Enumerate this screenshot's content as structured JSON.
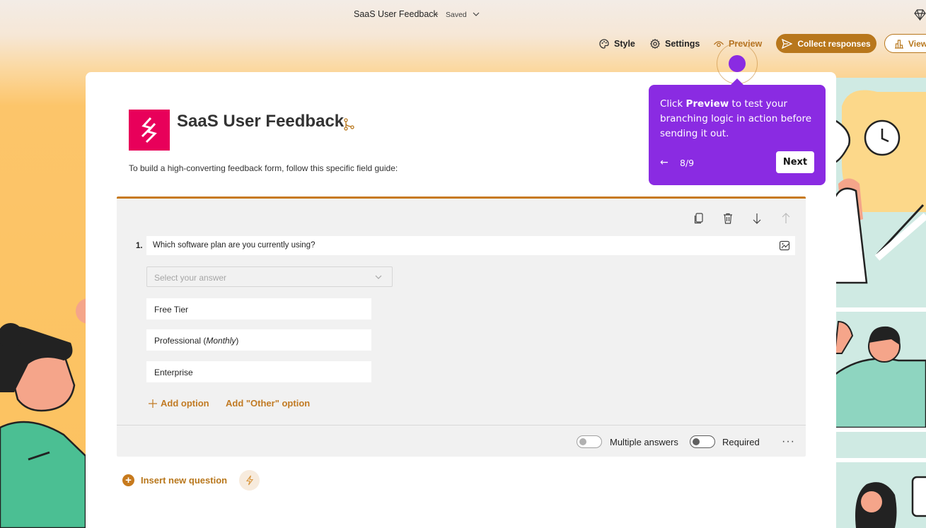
{
  "header": {
    "title": "SaaS User Feedback",
    "separator": "-",
    "status": "Saved"
  },
  "toolbar": {
    "style_label": "Style",
    "settings_label": "Settings",
    "preview_label": "Preview",
    "collect_label": "Collect responses",
    "view_label": "View"
  },
  "form": {
    "title": "SaaS User Feedback",
    "description": "To build a high-converting feedback form, follow this specific field guide:"
  },
  "question": {
    "number": "1.",
    "text": "Which software plan are you currently using?",
    "select_placeholder": "Select your answer",
    "options": {
      "o1": "Free Tier",
      "o2_main": "Professional (",
      "o2_em": "Monthly",
      "o2_end": ")",
      "o3": "Enterprise"
    },
    "add_option_label": "Add option",
    "add_other_label": "Add \"Other\" option",
    "multiple_answers_label": "Multiple answers",
    "required_label": "Required",
    "more_label": "···"
  },
  "insert": {
    "label": "Insert new question"
  },
  "tour": {
    "text_prefix": "Click ",
    "text_bold": "Preview",
    "text_suffix": " to test your branching logic in action before sending it out.",
    "back_label": "←",
    "step": "8/9",
    "next_label": "Next"
  },
  "colors": {
    "accent": "#b8771c",
    "tour": "#8a2be2",
    "logo": "#e8005a"
  }
}
